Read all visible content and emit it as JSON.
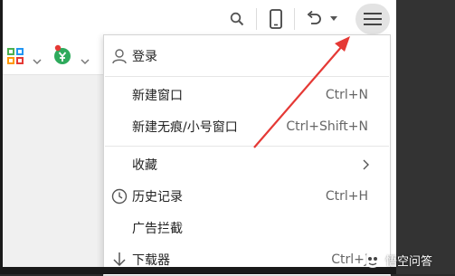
{
  "menu": {
    "login": "登录",
    "new_window": {
      "label": "新建窗口",
      "shortcut": "Ctrl+N"
    },
    "new_incognito": {
      "label": "新建无痕/小号窗口",
      "shortcut": "Ctrl+Shift+N"
    },
    "favorites": {
      "label": "收藏"
    },
    "history": {
      "label": "历史记录",
      "shortcut": "Ctrl+H"
    },
    "ad_block": {
      "label": "广告拦截"
    },
    "downloads": {
      "label": "下载器",
      "shortcut": "Ctrl+J"
    }
  },
  "watermark": {
    "text": "悟空问答"
  },
  "colors": {
    "annotation_arrow": "#e53935",
    "menu_button_bg": "#e3e3e3"
  },
  "icons": [
    "search-icon",
    "phone-icon",
    "undo-icon",
    "chevron-down-icon",
    "hamburger-menu-icon",
    "grid-apps-icon",
    "shield-icon",
    "user-icon",
    "clock-icon",
    "download-arrow-icon",
    "chevron-right-icon"
  ]
}
